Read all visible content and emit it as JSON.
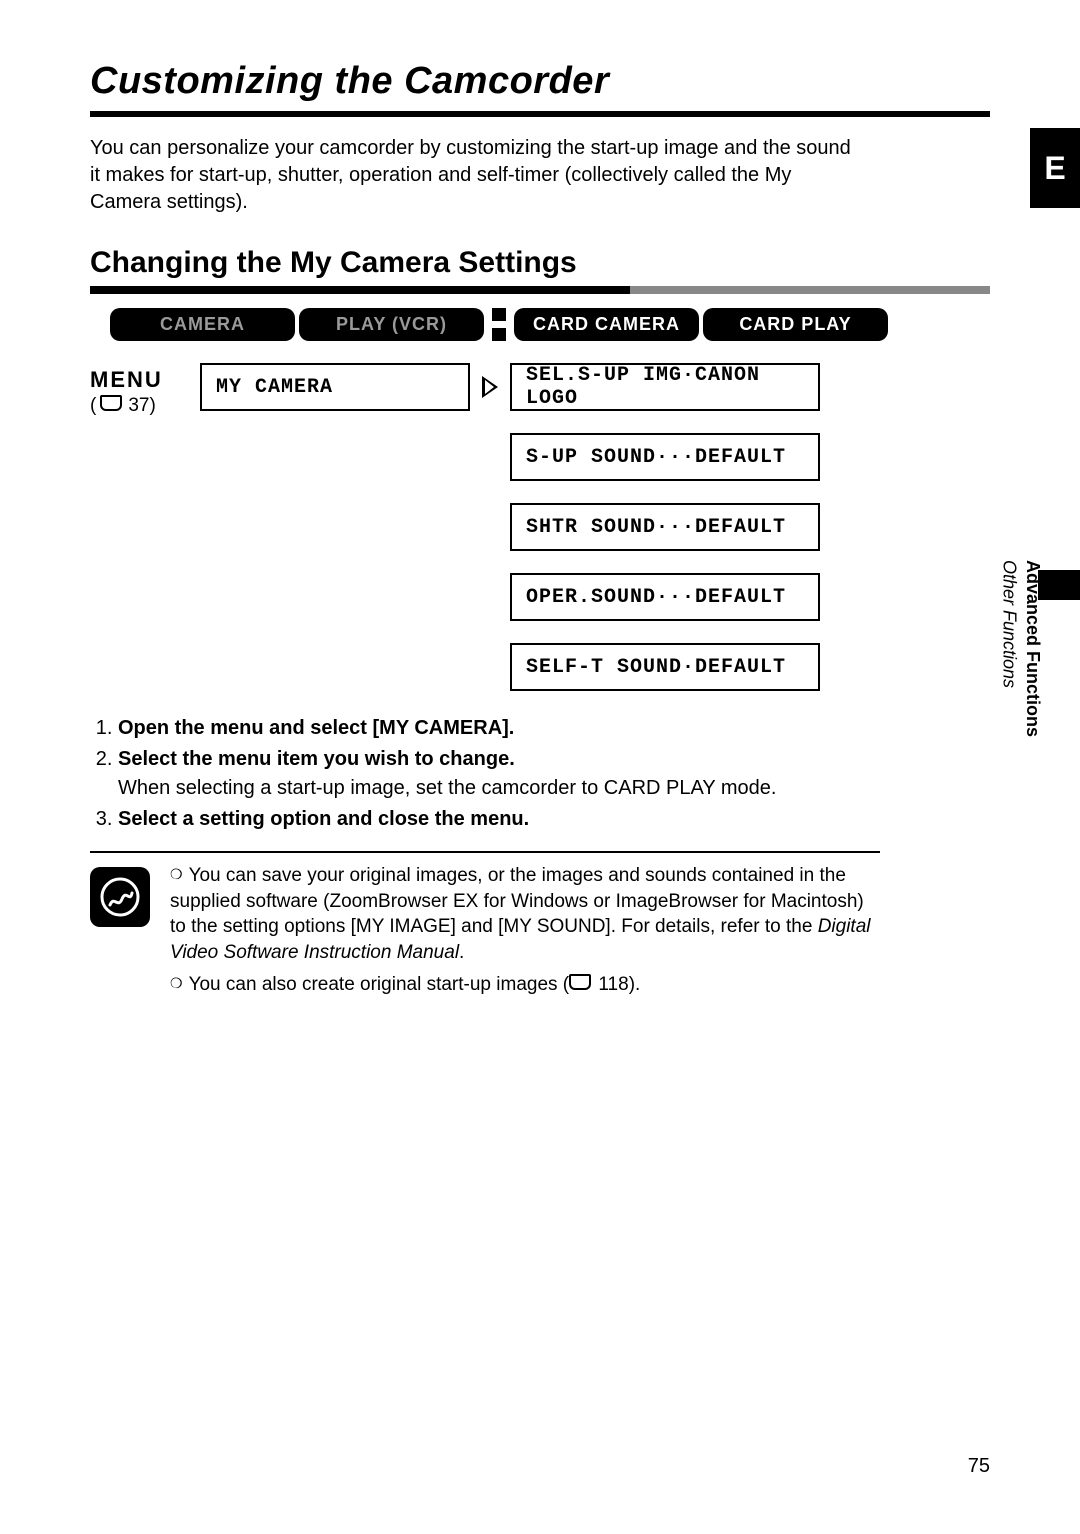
{
  "page": {
    "title": "Customizing the Camcorder",
    "intro": "You can personalize your camcorder by customizing the start-up image and the sound it makes for start-up, shutter, operation and self-timer (collectively called the My Camera settings).",
    "section_title": "Changing the My Camera Settings",
    "page_number": "75"
  },
  "sidebar": {
    "lang_badge": "E",
    "section_bold": "Advanced Functions",
    "section_ital": "Other Functions"
  },
  "modes": {
    "camera": "CAMERA",
    "play_vcr": "PLAY (VCR)",
    "card_camera": "CARD CAMERA",
    "card_play": "CARD PLAY"
  },
  "menu": {
    "label": "MENU",
    "ref": " 37)",
    "left_item": "MY CAMERA",
    "right_items": [
      "SEL.S-UP IMG·CANON LOGO",
      "S-UP SOUND···DEFAULT",
      "SHTR SOUND···DEFAULT",
      "OPER.SOUND···DEFAULT",
      "SELF-T SOUND·DEFAULT"
    ]
  },
  "steps": [
    {
      "main": "Open the menu and select [MY CAMERA]."
    },
    {
      "main": "Select the menu item you wish to change.",
      "sub": "When selecting a start-up image, set the camcorder to CARD PLAY mode."
    },
    {
      "main": "Select a setting option and close the menu."
    }
  ],
  "info": {
    "p1a": "You can save your original images, or the images and sounds contained in the supplied software (ZoomBrowser EX for Windows or ImageBrowser for Macintosh) to the setting options [MY IMAGE] and [MY SOUND]. For details, refer to the ",
    "p1b": "Digital Video Software Instruction Manual",
    "p1c": ".",
    "p2a": "You can also create original start-up images (",
    "p2_ref": " 118).",
    "book_glyph": "▢"
  }
}
